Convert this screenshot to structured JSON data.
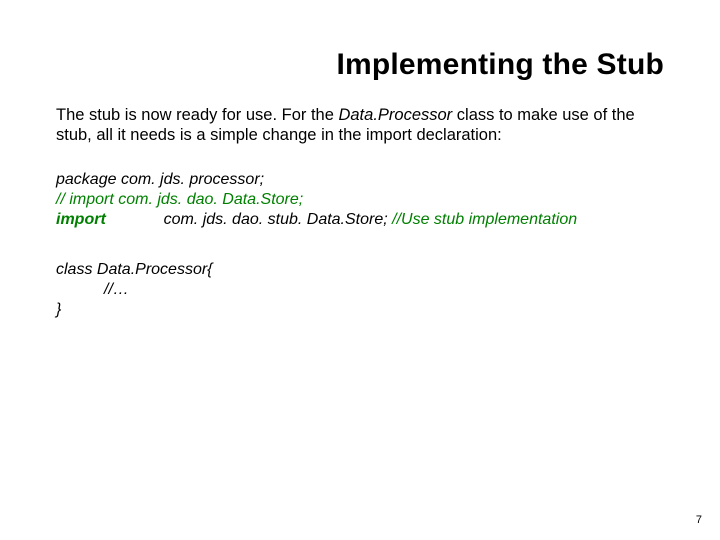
{
  "title": "Implementing the Stub",
  "intro": {
    "part1": "The stub is now ready for use.  For the ",
    "classname": "Data.Processor",
    "part2": " class to make use of the stub, all it needs is a simple change in the import declaration:"
  },
  "code": {
    "package": "package com. jds. processor;",
    "commented_import": "// import com. jds. dao. Data.Store;",
    "import_kw": "import",
    "import_gap": "             ",
    "import_path": "com. jds. dao. stub. Data.Store; ",
    "import_comment": "//Use stub implementation"
  },
  "classblock": {
    "l1": "class Data.Processor{",
    "l2": "//…",
    "l3": "}"
  },
  "page": "7"
}
